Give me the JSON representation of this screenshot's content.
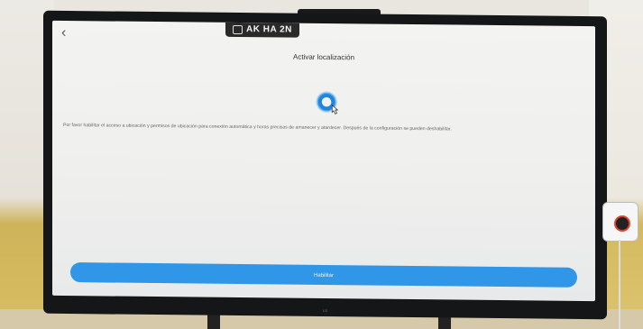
{
  "app": {
    "device_badge": "AK HA 2N",
    "back_icon": "chevron-left-icon"
  },
  "screen": {
    "title": "Activar localización",
    "location_icon": "location-icon",
    "description": "Por favor habilitar el acceso a ubicación y permisos de ubicación para conexión automática y horas precisas de amanecer y atardecer. Después de la configuración se pueden deshabilitar.",
    "enable_button": "Habilitar"
  },
  "tv": {
    "brand": "LG"
  },
  "colors": {
    "accent": "#2f96e8",
    "screen_bg": "#f2f2f0",
    "frame": "#151617"
  }
}
